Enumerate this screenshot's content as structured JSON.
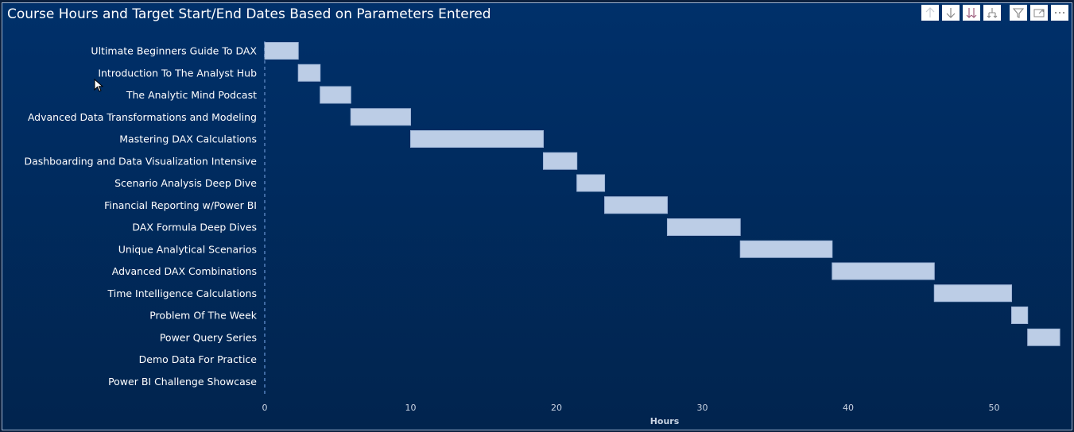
{
  "title": "Course Hours and Target Start/End Dates Based on Parameters Entered",
  "toolbar": [
    {
      "name": "sort-ascending-icon",
      "label": "Drill up"
    },
    {
      "name": "arrow-down-icon",
      "label": "Drill down"
    },
    {
      "name": "double-arrow-down-icon",
      "label": "Go to next level"
    },
    {
      "name": "expand-hierarchy-icon",
      "label": "Expand all"
    },
    {
      "name": "filter-icon",
      "label": "Filter"
    },
    {
      "name": "focus-mode-icon",
      "label": "Focus mode"
    },
    {
      "name": "more-options-icon",
      "label": "More options"
    }
  ],
  "colors": {
    "background": "#00306a",
    "bar": "#bccde6",
    "text": "#ffffff",
    "axis": "#c9d4e3",
    "baseline": "#3f6aa3"
  },
  "chart_data": {
    "type": "bar",
    "orientation": "horizontal-gantt",
    "title": "Course Hours and Target Start/End Dates Based on Parameters Entered",
    "xlabel": "Hours",
    "ylabel": "",
    "xlim": [
      0,
      55
    ],
    "xticks": [
      0,
      10,
      20,
      30,
      40,
      50
    ],
    "grid": false,
    "categories": [
      "Ultimate Beginners Guide To DAX",
      "Introduction To The Analyst Hub",
      "The Analytic Mind Podcast",
      "Advanced Data Transformations and Modeling",
      "Mastering DAX Calculations",
      "Dashboarding and Data Visualization Intensive",
      "Scenario Analysis Deep Dive",
      "Financial Reporting w/Power BI",
      "DAX Formula Deep Dives",
      "Unique Analytical Scenarios",
      "Advanced DAX Combinations",
      "Time Intelligence Calculations",
      "Problem Of The Week",
      "Power Query Series",
      "Demo Data For Practice",
      "Power BI Challenge Showcase"
    ],
    "start": [
      0,
      2.3,
      3.8,
      5.9,
      10.0,
      19.1,
      21.4,
      23.3,
      27.6,
      32.6,
      38.9,
      45.9,
      51.2,
      52.3,
      null,
      null
    ],
    "end": [
      2.3,
      3.8,
      5.9,
      10.0,
      19.1,
      21.4,
      23.3,
      27.6,
      32.6,
      38.9,
      45.9,
      51.2,
      52.3,
      54.5,
      null,
      null
    ]
  }
}
